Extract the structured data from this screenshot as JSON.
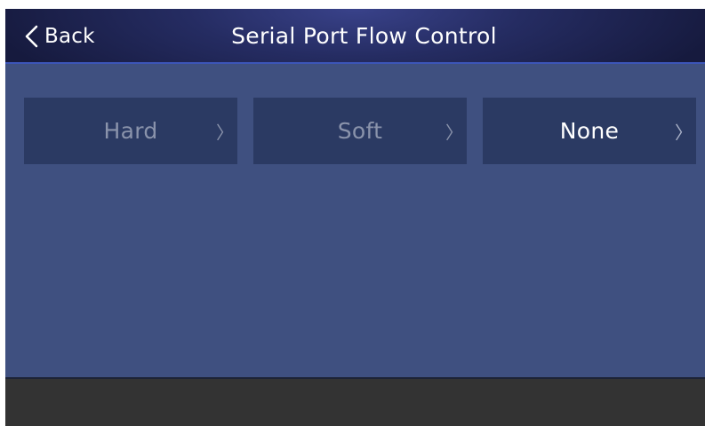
{
  "header": {
    "back_label": "Back",
    "title": "Serial Port Flow Control"
  },
  "options": [
    {
      "label": "Hard",
      "chevron": "〉",
      "selected": false
    },
    {
      "label": "Soft",
      "chevron": "〉",
      "selected": false
    },
    {
      "label": "None",
      "chevron": "〉",
      "selected": true
    }
  ],
  "colors": {
    "content_background": "#3f5080",
    "option_background": "#2b3a63",
    "unselected_text": "#8a93ab",
    "selected_text": "#ffffff",
    "footer_background": "#333333"
  }
}
